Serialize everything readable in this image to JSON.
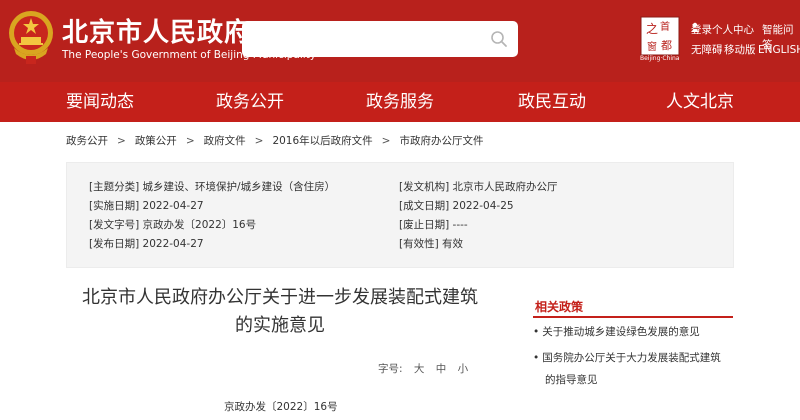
{
  "header": {
    "site_title": "北京市人民政府",
    "site_subtitle": "The People's Government of Beijing Municipality",
    "search_placeholder": "",
    "top_links": {
      "login": "登录个人中心",
      "smart_qa": "智能问答",
      "accessibility": "无障碍",
      "mobile": "移动版",
      "english": "ENGLISH"
    },
    "capital_caption": "Beijing·China"
  },
  "nav": {
    "items": [
      "要闻动态",
      "政务公开",
      "政务服务",
      "政民互动",
      "人文北京"
    ]
  },
  "breadcrumb": [
    "政务公开",
    "政策公开",
    "政府文件",
    "2016年以后政府文件",
    "市政府办公厅文件"
  ],
  "meta": {
    "topic": "[主题分类] 城乡建设、环境保护/城乡建设（含住房）",
    "issuer": "[发文机构] 北京市人民政府办公厅",
    "effective_date": "[实施日期] 2022-04-27",
    "created_date": "[成文日期] 2022-04-25",
    "doc_no": "[发文字号] 京政办发〔2022〕16号",
    "abolish_date": "[废止日期] ----",
    "publish_date": "[发布日期] 2022-04-27",
    "validity": "[有效性] 有效"
  },
  "article": {
    "title_line1": "北京市人民政府办公厅关于进一步发展装配式建筑",
    "title_line2": "的实施意见",
    "font_size_label": "字号:",
    "font_large": "大",
    "font_medium": "中",
    "font_small": "小",
    "doc_number": "京政办发〔2022〕16号"
  },
  "related": {
    "heading": "相关政策",
    "items": [
      "关于推动城乡建设绿色发展的意见",
      "国务院办公厅关于大力发展装配式建筑",
      "的指导意见"
    ]
  }
}
